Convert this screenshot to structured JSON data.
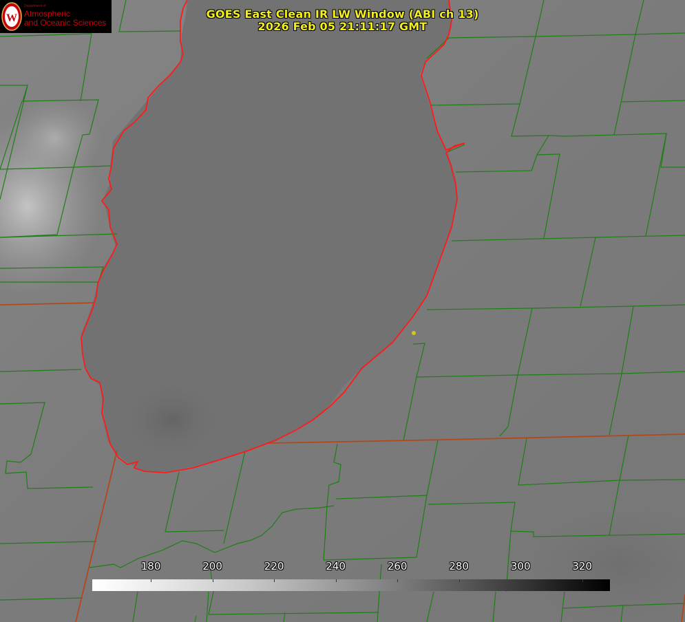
{
  "title": {
    "line1": "GOES East Clean IR LW Window (ABI ch 13)",
    "line2": "2026 Feb 05 21:11:17 GMT"
  },
  "logo": {
    "department": "Department of",
    "line1": "Atmospheric",
    "line2": "and Oceanic Sciences"
  },
  "colorbar": {
    "ticks": [
      "180",
      "200",
      "220",
      "240",
      "260",
      "280",
      "300",
      "320"
    ],
    "tick_values": [
      180,
      200,
      220,
      240,
      260,
      280,
      300,
      320
    ],
    "range_min": 161,
    "range_max": 329,
    "colormap": "white-to-black"
  },
  "colors": {
    "county_lines": "#1d7f14",
    "state_lines": "#b4471a",
    "lake_shore": "#ff1a1a",
    "text": "#f2ef1d",
    "marker": "#d8c61a"
  }
}
